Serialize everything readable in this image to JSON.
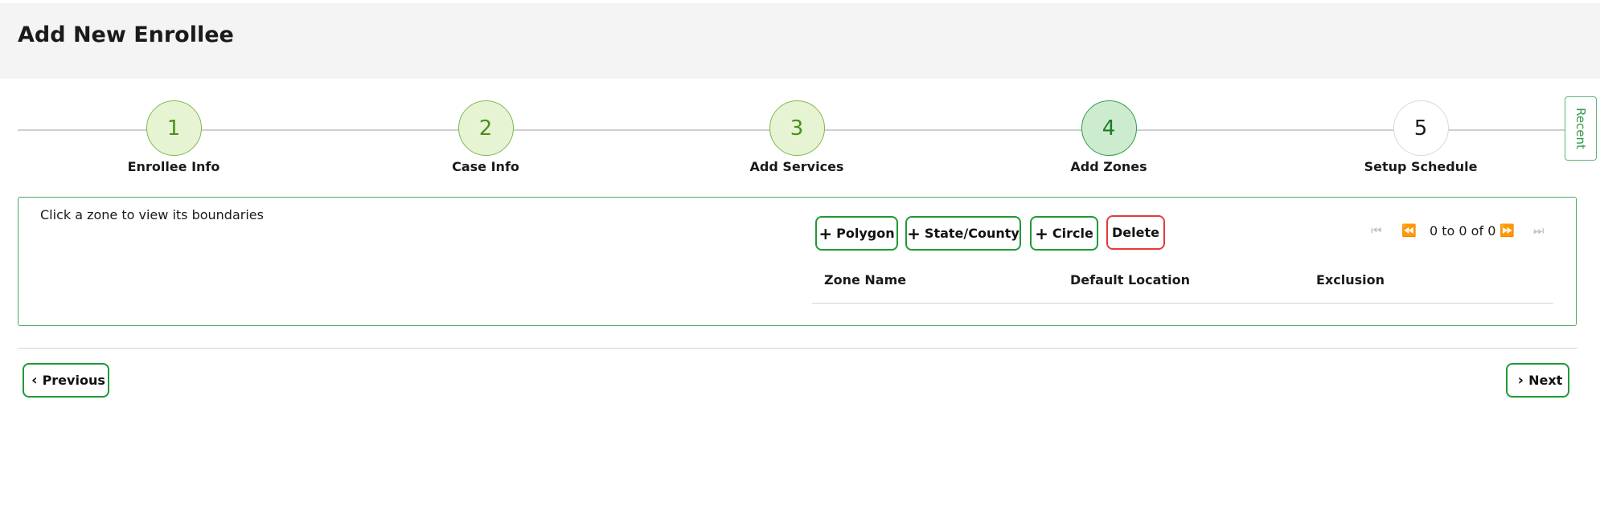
{
  "header": {
    "title": "Add New Enrollee"
  },
  "recent_tab": {
    "label": "Recent"
  },
  "steps": [
    {
      "number": "1",
      "label": "Enrollee Info",
      "state": "done"
    },
    {
      "number": "2",
      "label": "Case Info",
      "state": "done"
    },
    {
      "number": "3",
      "label": "Add Services",
      "state": "done"
    },
    {
      "number": "4",
      "label": "Add Zones",
      "state": "active"
    },
    {
      "number": "5",
      "label": "Setup Schedule",
      "state": "todo"
    }
  ],
  "zones": {
    "hint": "Click a zone to view its boundaries",
    "buttons": {
      "polygon": "Polygon",
      "state_county": "State/County",
      "circle": "Circle",
      "delete": "Delete"
    },
    "pager": {
      "text": "0 to 0 of 0"
    },
    "columns": [
      "Zone Name",
      "Default Location",
      "Exclusion"
    ]
  },
  "footer": {
    "previous": "Previous",
    "next": "Next"
  },
  "colors": {
    "accent": "#1f9a35",
    "danger": "#e33b3b",
    "step_done_fill": "#e6f4d3",
    "step_active_fill": "#cdeccf",
    "header_bg": "#f4f4f4"
  }
}
